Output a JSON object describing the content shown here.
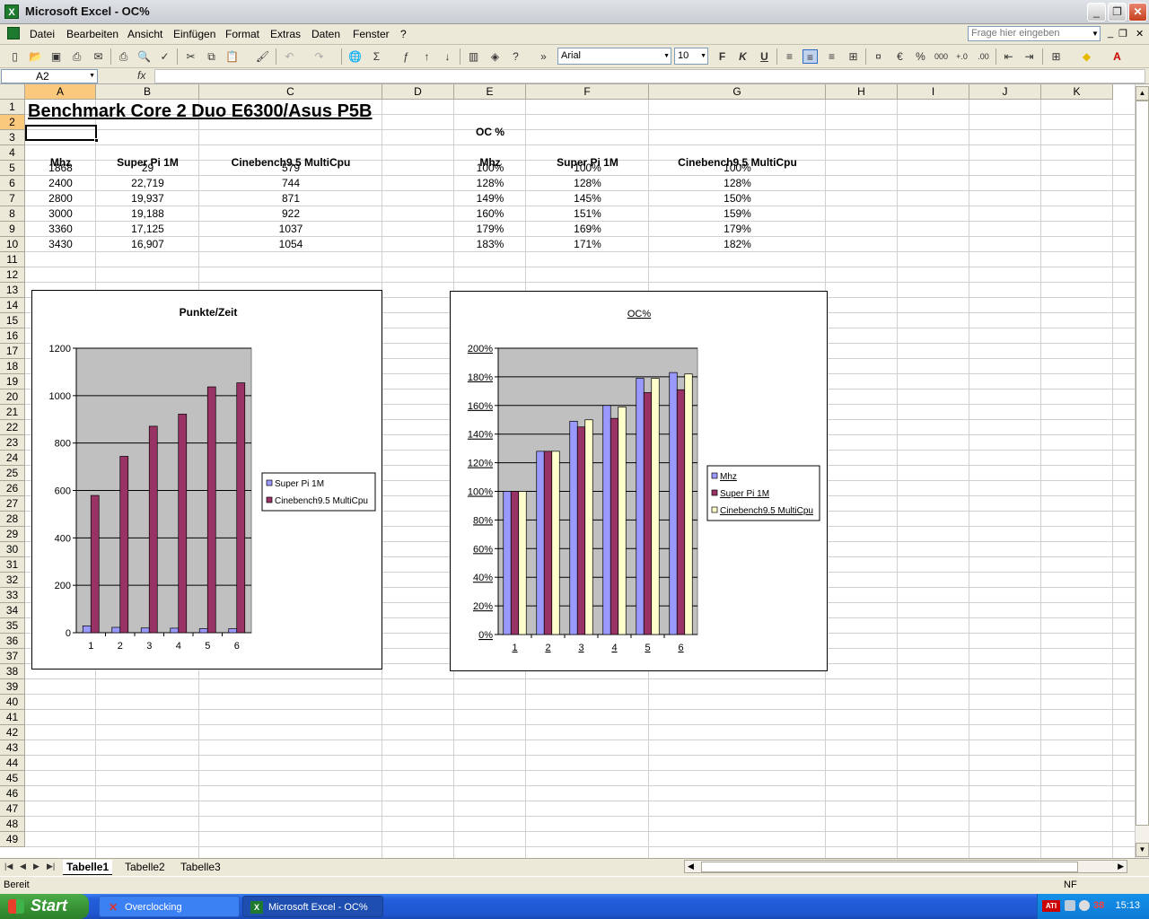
{
  "window": {
    "title": "Microsoft Excel - OC%",
    "app_icon": "X"
  },
  "menu": {
    "items": [
      "Datei",
      "Bearbeiten",
      "Ansicht",
      "Einfügen",
      "Format",
      "Extras",
      "Daten",
      "Fenster",
      "?"
    ],
    "ask_placeholder": "Frage hier eingeben"
  },
  "toolbar": {
    "font": "Arial",
    "size": "10",
    "bold": "F",
    "italic": "K",
    "underline": "U",
    "euro": "€",
    "percent": "%",
    "thousands": "000",
    "sum": "Σ"
  },
  "formula": {
    "namebox": "A2",
    "fx": "fx",
    "content": ""
  },
  "columns": [
    "A",
    "B",
    "C",
    "D",
    "E",
    "F",
    "G",
    "H",
    "I",
    "J",
    "K"
  ],
  "sheet": {
    "title": "Benchmark Core 2 Duo E6300/Asus P5B",
    "oc_label": "OC %",
    "left_headers": [
      "Mhz",
      "Super Pi 1M",
      "Cinebench9.5 MultiCpu"
    ],
    "right_headers": [
      "Mhz",
      "Super Pi 1M",
      "Cinebench9.5 MultiCpu"
    ],
    "rows": [
      [
        "1868",
        "29",
        "579",
        "100%",
        "100%",
        "100%"
      ],
      [
        "2400",
        "22,719",
        "744",
        "128%",
        "128%",
        "128%"
      ],
      [
        "2800",
        "19,937",
        "871",
        "149%",
        "145%",
        "150%"
      ],
      [
        "3000",
        "19,188",
        "922",
        "160%",
        "151%",
        "159%"
      ],
      [
        "3360",
        "17,125",
        "1037",
        "179%",
        "169%",
        "179%"
      ],
      [
        "3430",
        "16,907",
        "1054",
        "183%",
        "171%",
        "182%"
      ]
    ]
  },
  "chart_data": [
    {
      "type": "bar",
      "title": "Punkte/Zeit",
      "categories": [
        "1",
        "2",
        "3",
        "4",
        "5",
        "6"
      ],
      "series": [
        {
          "name": "Super Pi 1M",
          "values": [
            29,
            22.719,
            19.937,
            19.188,
            17.125,
            16.907
          ],
          "color": "#9999ff"
        },
        {
          "name": "Cinebench9.5 MultiCpu",
          "values": [
            579,
            744,
            871,
            922,
            1037,
            1054
          ],
          "color": "#993366"
        }
      ],
      "ylim": [
        0,
        1200
      ],
      "yticks": [
        "0",
        "200",
        "400",
        "600",
        "800",
        "1000",
        "1200"
      ],
      "grid": true,
      "plot_background": "#c0c0c0",
      "legend": "right"
    },
    {
      "type": "bar",
      "title": "OC%",
      "categories": [
        "1",
        "2",
        "3",
        "4",
        "5",
        "6"
      ],
      "series": [
        {
          "name": "Mhz",
          "values": [
            100,
            128,
            149,
            160,
            179,
            183
          ],
          "color": "#9999ff"
        },
        {
          "name": "Super Pi 1M",
          "values": [
            100,
            128,
            145,
            151,
            169,
            171
          ],
          "color": "#993366"
        },
        {
          "name": "Cinebench9.5 MultiCpu",
          "values": [
            100,
            128,
            150,
            159,
            179,
            182
          ],
          "color": "#ffffcc"
        }
      ],
      "ylim": [
        0,
        200
      ],
      "yticks": [
        "0%",
        "20%",
        "40%",
        "60%",
        "80%",
        "100%",
        "120%",
        "140%",
        "160%",
        "180%",
        "200%"
      ],
      "grid": true,
      "plot_background": "#c0c0c0",
      "legend": "right"
    }
  ],
  "tabs": [
    "Tabelle1",
    "Tabelle2",
    "Tabelle3"
  ],
  "status": {
    "left": "Bereit",
    "right": "NF"
  },
  "taskbar": {
    "start": "Start",
    "items": [
      "Overclocking",
      "Microsoft Excel - OC%"
    ],
    "tray_ati": "ATI",
    "tray_num": "38",
    "clock": "15:13"
  }
}
